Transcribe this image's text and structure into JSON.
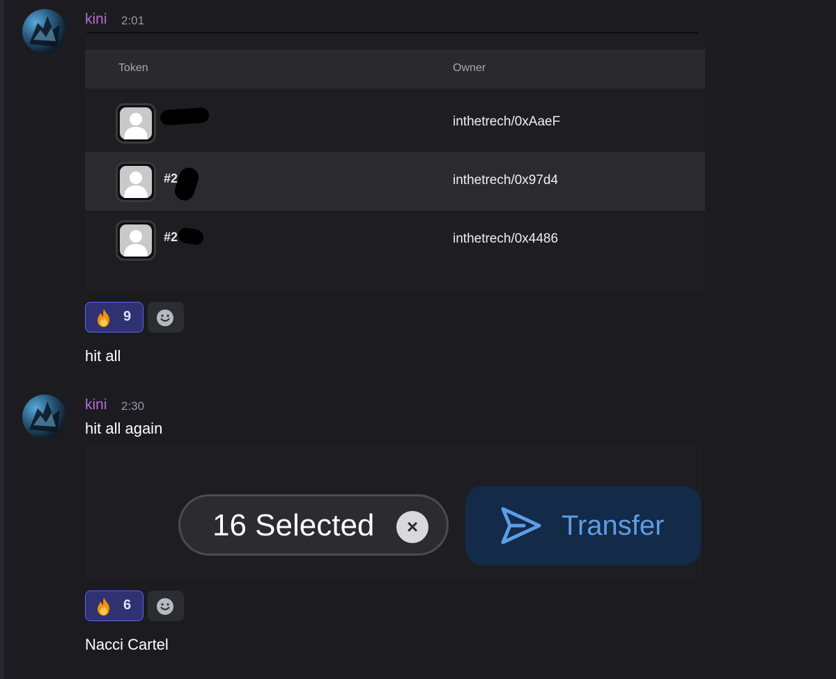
{
  "messages": [
    {
      "author": "kini",
      "time": "2:01",
      "table": {
        "headers": {
          "token": "Token",
          "owner": "Owner"
        },
        "rows": [
          {
            "token_id": "",
            "owner": "inthetrech/0xAaeF"
          },
          {
            "token_id": "#2",
            "owner": "inthetrech/0x97d4"
          },
          {
            "token_id": "#2",
            "owner": "inthetrech/0x4486"
          }
        ]
      },
      "reaction": {
        "emoji": "fire-emoji",
        "count": "9"
      },
      "follow_text": "hit all"
    },
    {
      "author": "kini",
      "time": "2:30",
      "text": "hit all again",
      "selection_bar": {
        "selected_label": "16 Selected",
        "clear_glyph": "×",
        "transfer_label": "Transfer"
      },
      "reaction": {
        "emoji": "fire-emoji",
        "count": "6"
      },
      "follow_text": "Nacci Cartel"
    }
  ],
  "colors": {
    "background": "#1b1b20",
    "username": "#b56fd2",
    "reaction_active": "#2f3270",
    "transfer_button": "#142a49",
    "transfer_accent": "#5c9ee6"
  }
}
